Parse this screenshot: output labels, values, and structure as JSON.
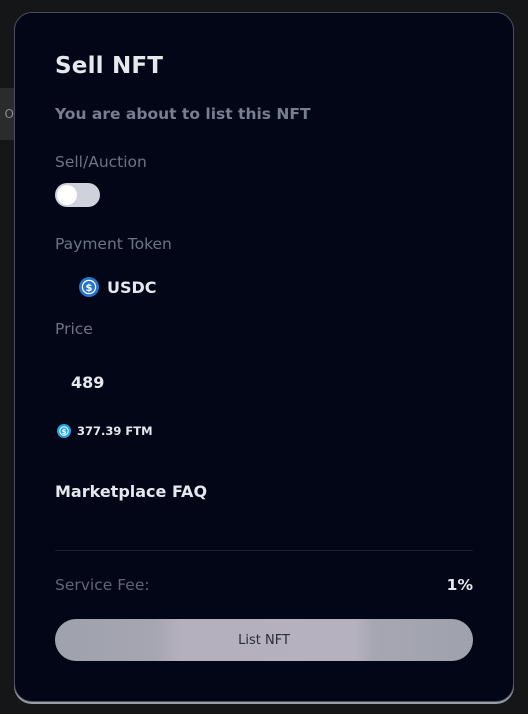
{
  "backdrop": {
    "partial_text": "O"
  },
  "modal": {
    "title": "Sell NFT",
    "subtitle": "You are about to list this NFT",
    "sell_auction_label": "Sell/Auction",
    "sell_auction_toggle": {
      "on": false
    },
    "payment_token_label": "Payment Token",
    "payment_token": {
      "name": "USDC",
      "icon": "usdc-icon"
    },
    "price_label": "Price",
    "price_value": "489",
    "conversion": {
      "text": "377.39 FTM",
      "icon": "ftm-icon"
    },
    "faq_label": "Marketplace FAQ",
    "service_fee_label": "Service Fee:",
    "service_fee_value": "1%",
    "list_button_label": "List NFT"
  },
  "colors": {
    "modal_bg": "#020617",
    "usdc": "#2775ca",
    "ftm": "#1fa4e8",
    "button": "#a5a6b1"
  }
}
